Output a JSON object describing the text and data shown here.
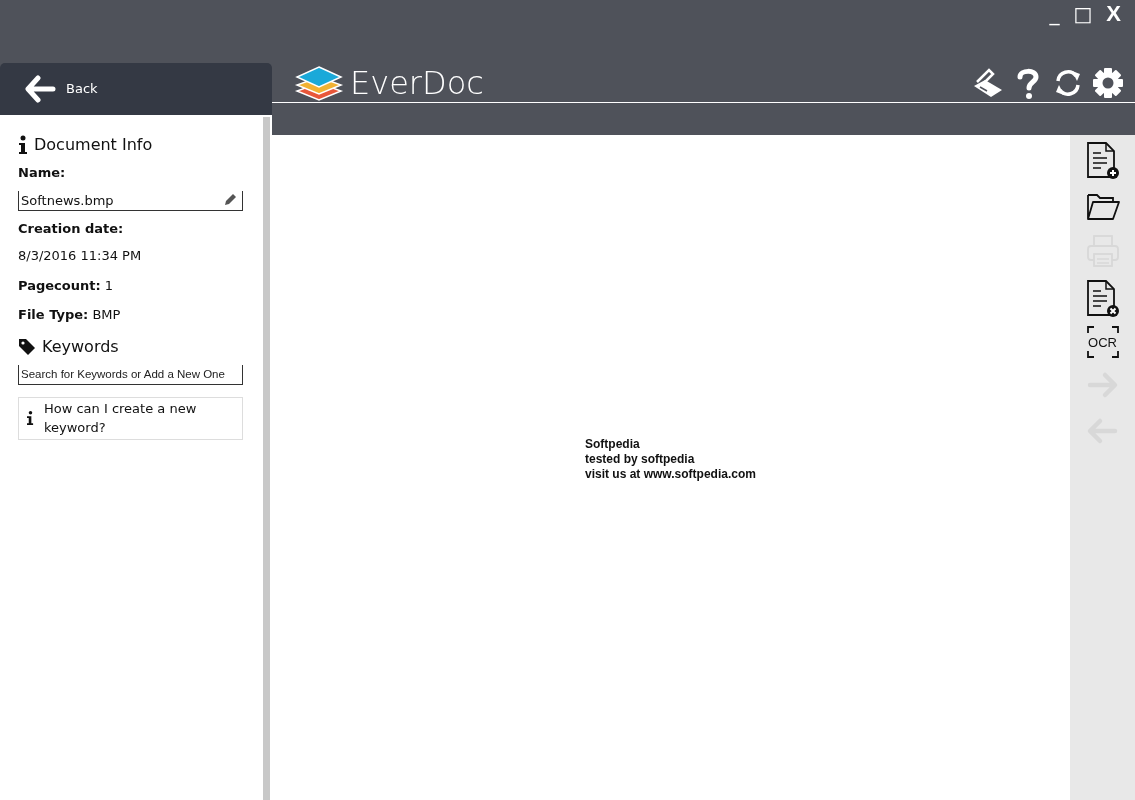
{
  "window_controls": [
    "_",
    "□",
    "X"
  ],
  "back_button": {
    "label": "Back"
  },
  "app": {
    "title": "EverDoc"
  },
  "header_tools": [
    {
      "kind": "scanner"
    },
    {
      "kind": "help"
    },
    {
      "kind": "sync"
    },
    {
      "kind": "settings"
    }
  ],
  "document_info": {
    "heading": "Document Info",
    "name_label": "Name:",
    "name_value": "Softnews.bmp",
    "creation_label": "Creation date:",
    "creation_value": "8/3/2016 11:34 PM",
    "pagecount": "**Pagecount:** 1",
    "filetype": "**File Type:** BMP"
  },
  "keywords": {
    "heading": "Keywords",
    "placeholder": "Search for Keywords or Add a New One",
    "help": "How can I create a new keyword?"
  },
  "document": {
    "lines": [
      "Softpedia",
      "tested by softpedia",
      "visit us at www.softpedia.com"
    ]
  },
  "tools": [
    {
      "kind": "new-document",
      "disabled": false
    },
    {
      "kind": "open",
      "disabled": false
    },
    {
      "kind": "print",
      "disabled": true
    },
    {
      "kind": "close-document",
      "disabled": false
    },
    {
      "kind": "ocr",
      "label": "OCR",
      "disabled": false
    },
    {
      "kind": "forward",
      "disabled": true
    },
    {
      "kind": "back",
      "disabled": true
    }
  ]
}
